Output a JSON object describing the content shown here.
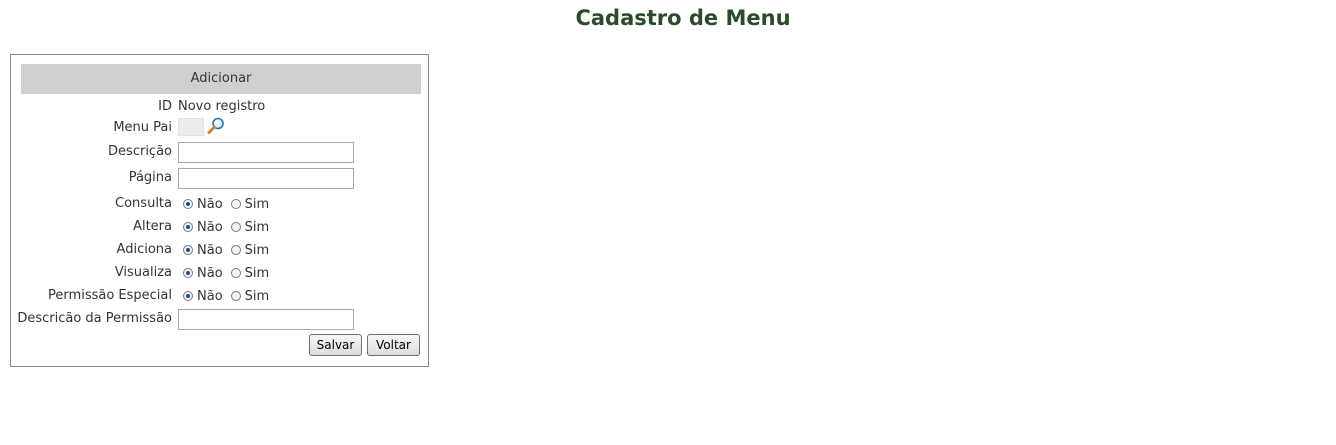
{
  "page": {
    "title": "Cadastro de Menu"
  },
  "panel": {
    "header": "Adicionar"
  },
  "fields": {
    "id": {
      "label": "ID",
      "value": "Novo registro"
    },
    "menu_pai": {
      "label": "Menu Pai"
    },
    "descricao": {
      "label": "Descrição",
      "value": ""
    },
    "pagina": {
      "label": "Página",
      "value": ""
    },
    "consulta": {
      "label": "Consulta",
      "selected": "Não"
    },
    "altera": {
      "label": "Altera",
      "selected": "Não"
    },
    "adiciona": {
      "label": "Adiciona",
      "selected": "Não"
    },
    "visualiza": {
      "label": "Visualiza",
      "selected": "Não"
    },
    "permissao_especial": {
      "label": "Permissão Especial",
      "selected": "Não"
    },
    "descricao_permissao": {
      "label": "Descricão da Permissão",
      "value": ""
    }
  },
  "radio_options": {
    "no": "Não",
    "yes": "Sim"
  },
  "buttons": {
    "save": "Salvar",
    "back": "Voltar"
  },
  "icons": {
    "lookup": "magnifier-search-icon"
  },
  "colors": {
    "title": "#2b4b2b",
    "header_bg": "#cfcfcf",
    "radio_dot": "#1f4e8a"
  }
}
